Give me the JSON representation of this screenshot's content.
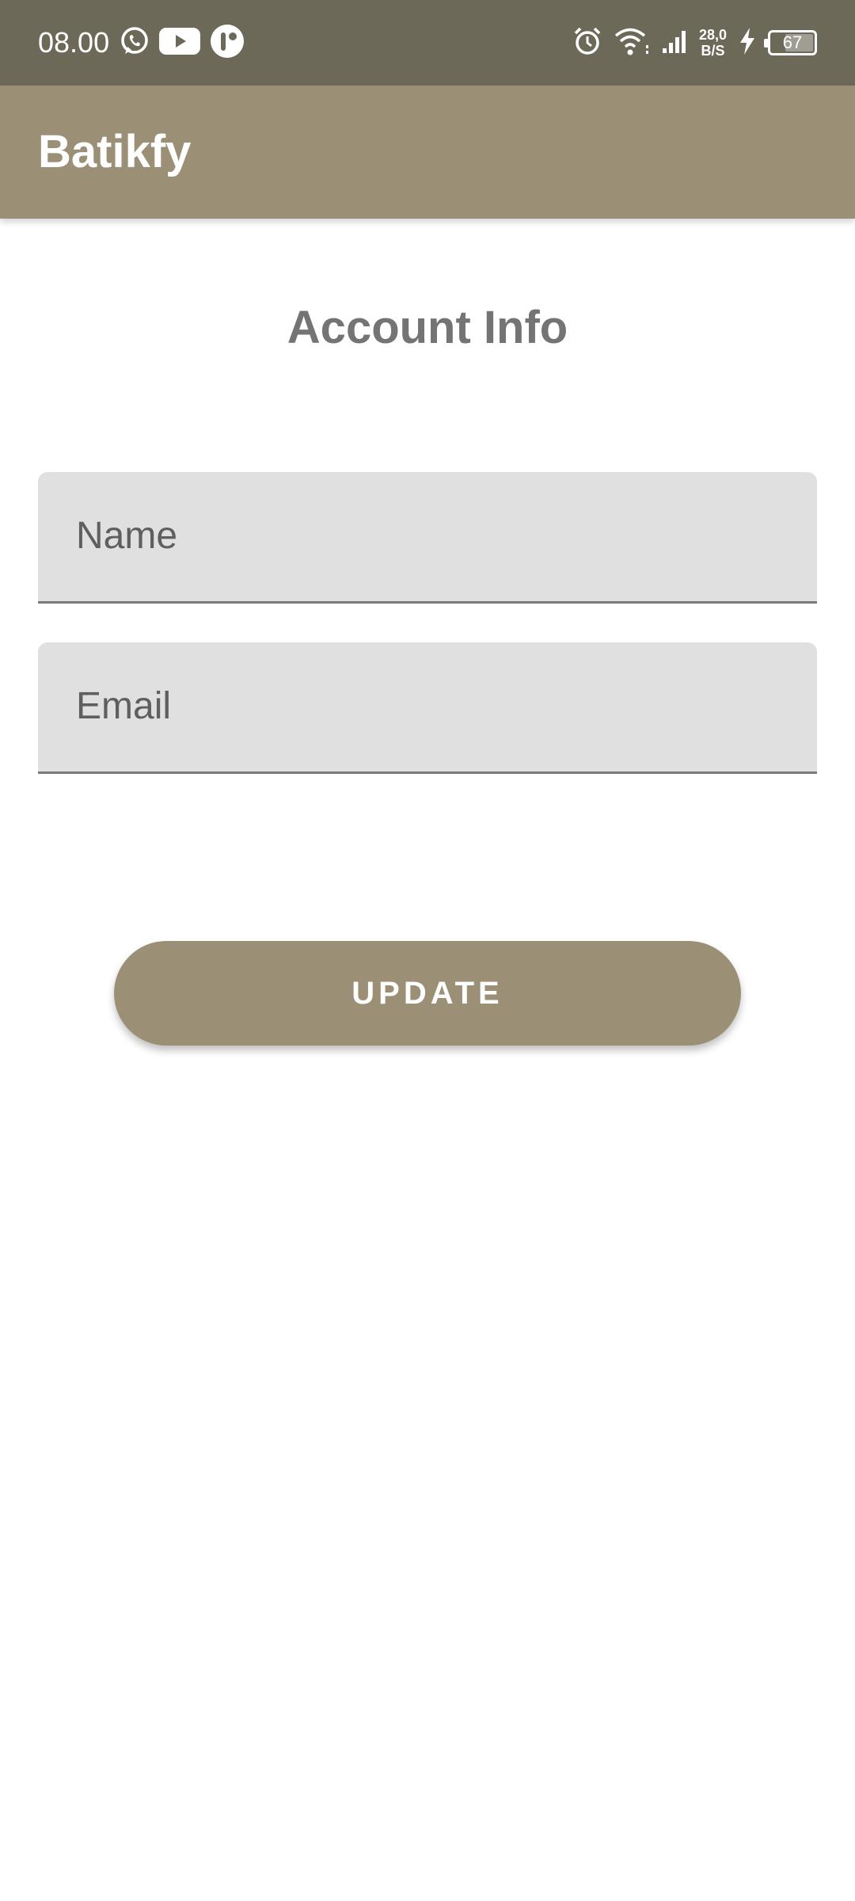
{
  "status_bar": {
    "time": "08.00",
    "left_icons": [
      "whatsapp-icon",
      "youtube-icon",
      "app-notification-icon"
    ],
    "right_icons": [
      "alarm-icon",
      "wifi-icon",
      "signal-icon",
      "charging-icon"
    ],
    "net_speed_value": "28,0",
    "net_speed_unit": "B/S",
    "battery_level": "67"
  },
  "app_bar": {
    "title": "Batikfy"
  },
  "main": {
    "heading": "Account Info",
    "name_field": {
      "placeholder": "Name",
      "value": ""
    },
    "email_field": {
      "placeholder": "Email",
      "value": ""
    },
    "update_label": "UPDATE"
  },
  "colors": {
    "status_bar": "#6d6959",
    "app_bar": "#9b8f76",
    "button": "#9b8f76",
    "heading_text": "#747474",
    "field_background": "#e0e0e0"
  }
}
